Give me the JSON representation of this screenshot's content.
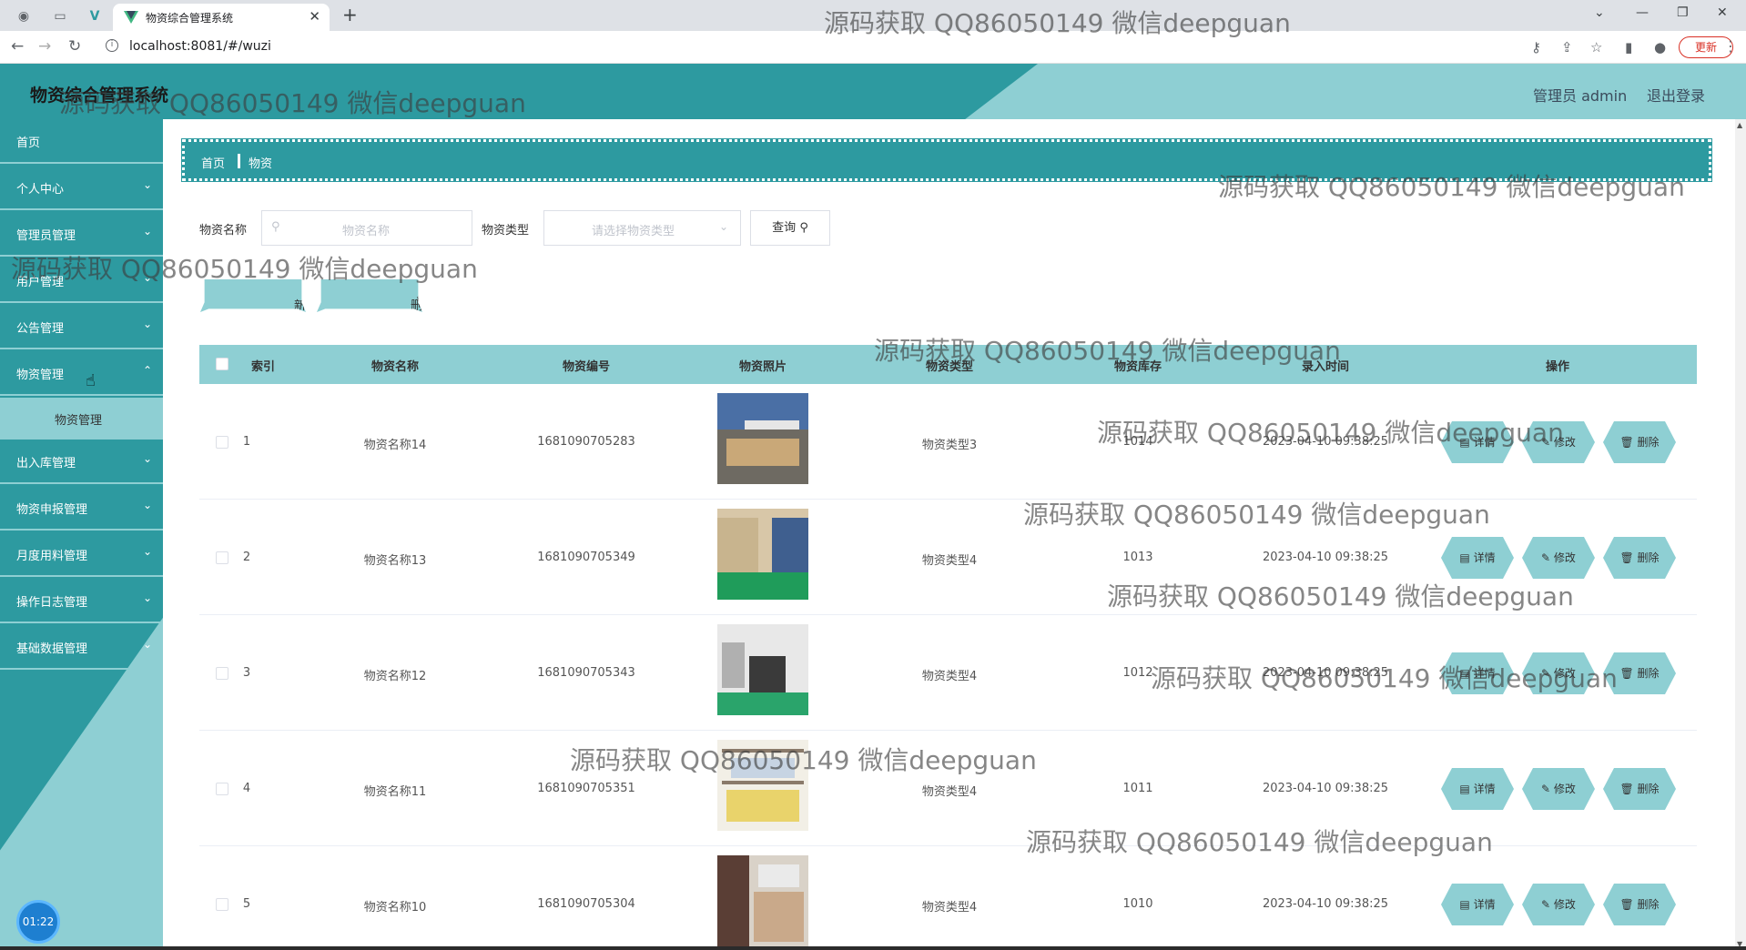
{
  "browser": {
    "tab_title": "物资综合管理系统",
    "url": "localhost:8081/#/wuzi",
    "update_label": "更新"
  },
  "app": {
    "title": "物资综合管理系统",
    "user_label": "管理员 admin",
    "logout_label": "退出登录"
  },
  "sidebar": {
    "items": [
      {
        "label": "首页"
      },
      {
        "label": "个人中心"
      },
      {
        "label": "管理员管理"
      },
      {
        "label": "用户管理"
      },
      {
        "label": "公告管理"
      },
      {
        "label": "物资管理"
      },
      {
        "label": "出入库管理"
      },
      {
        "label": "物资申报管理"
      },
      {
        "label": "月度用料管理"
      },
      {
        "label": "操作日志管理"
      },
      {
        "label": "基础数据管理"
      }
    ],
    "submenu": {
      "label": "物资管理"
    },
    "timer": "01:22"
  },
  "breadcrumb": {
    "home": "首页",
    "current": "物资"
  },
  "search": {
    "name_label": "物资名称",
    "name_placeholder": "物资名称",
    "type_label": "物资类型",
    "type_placeholder": "请选择物资类型",
    "query_label": "查询"
  },
  "actions": {
    "add_label": "新增",
    "delete_label": "删除"
  },
  "table": {
    "headers": [
      "索引",
      "物资名称",
      "物资编号",
      "物资照片",
      "物资类型",
      "物资库存",
      "录入时间",
      "操作"
    ],
    "op_labels": {
      "detail": "详情",
      "edit": "修改",
      "delete": "删除"
    },
    "rows": [
      {
        "index": "1",
        "name": "物资名称14",
        "code": "1681090705283",
        "type": "物资类型3",
        "stock": "1014",
        "time": "2023-04-10 09:38:25"
      },
      {
        "index": "2",
        "name": "物资名称13",
        "code": "1681090705349",
        "type": "物资类型4",
        "stock": "1013",
        "time": "2023-04-10 09:38:25"
      },
      {
        "index": "3",
        "name": "物资名称12",
        "code": "1681090705343",
        "type": "物资类型4",
        "stock": "1012",
        "time": "2023-04-10 09:38:25"
      },
      {
        "index": "4",
        "name": "物资名称11",
        "code": "1681090705351",
        "type": "物资类型4",
        "stock": "1011",
        "time": "2023-04-10 09:38:25"
      },
      {
        "index": "5",
        "name": "物资名称10",
        "code": "1681090705304",
        "type": "物资类型4",
        "stock": "1010",
        "time": "2023-04-10 09:38:25"
      }
    ]
  },
  "watermark": "源码获取 QQ86050149 微信deepguan",
  "colors": {
    "dark_teal": "#2d9aa0",
    "light_teal": "#8ecfd3"
  }
}
